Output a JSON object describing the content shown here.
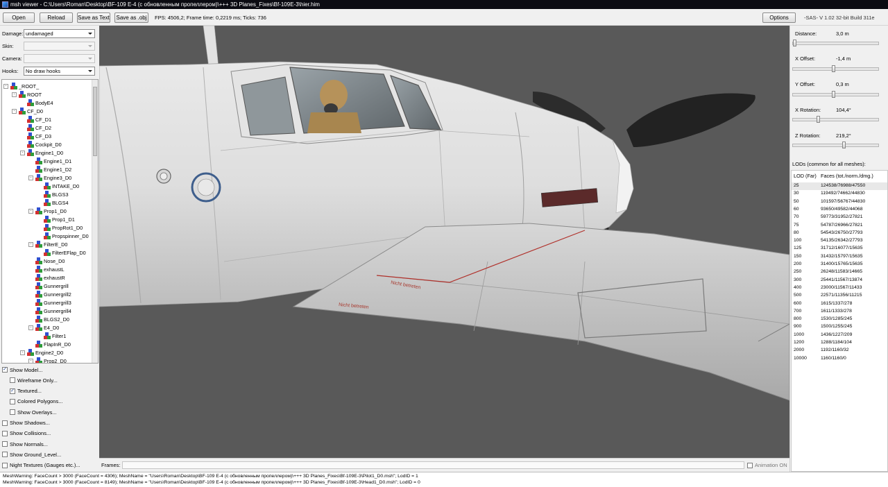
{
  "window": {
    "title": "msh viewer - C:\\Users\\Roman\\Desktop\\BF-109 E-4 (с обновленным пропеллером)\\+++ 3D Planes_Fixes\\Bf-109E-3\\hier.him"
  },
  "toolbar": {
    "open": "Open",
    "reload": "Reload",
    "save_text": "Save as Text",
    "save_obj": "Save as .obj",
    "fps": "FPS: 4506,2; Frame time: 0,2219 ms; Ticks: 736",
    "options": "Options",
    "version": "-SAS- V 1.02  32-bit  Build 311e"
  },
  "left": {
    "damage_label": "Damage:",
    "damage_value": "undamaged",
    "skin_label": "Skin:",
    "skin_value": "",
    "camera_label": "Camera:",
    "camera_value": "",
    "hooks_label": "Hooks:",
    "hooks_value": "No draw hooks",
    "tree": [
      {
        "label": "_ROOT_",
        "depth": 0,
        "expander": "-",
        "root": true
      },
      {
        "label": "ROOT",
        "depth": 1,
        "expander": "-"
      },
      {
        "label": "BodyE4",
        "depth": 2,
        "expander": ""
      },
      {
        "label": "CF_D0",
        "depth": 1,
        "expander": "-"
      },
      {
        "label": "CF_D1",
        "depth": 2,
        "expander": ""
      },
      {
        "label": "CF_D2",
        "depth": 2,
        "expander": ""
      },
      {
        "label": "CF_D3",
        "depth": 2,
        "expander": ""
      },
      {
        "label": "Cockpit_D0",
        "depth": 2,
        "expander": ""
      },
      {
        "label": "Engine1_D0",
        "depth": 2,
        "expander": "-"
      },
      {
        "label": "Engine1_D1",
        "depth": 3,
        "expander": ""
      },
      {
        "label": "Engine1_D2",
        "depth": 3,
        "expander": ""
      },
      {
        "label": "Engine3_D0",
        "depth": 3,
        "expander": "-"
      },
      {
        "label": "INTAKE_D0",
        "depth": 4,
        "expander": ""
      },
      {
        "label": "BLGS3",
        "depth": 4,
        "expander": ""
      },
      {
        "label": "BLGS4",
        "depth": 4,
        "expander": ""
      },
      {
        "label": "Prop1_D0",
        "depth": 3,
        "expander": "-"
      },
      {
        "label": "Prop1_D1",
        "depth": 4,
        "expander": ""
      },
      {
        "label": "PropRot1_D0",
        "depth": 4,
        "expander": ""
      },
      {
        "label": "Propspinner_D0",
        "depth": 4,
        "expander": ""
      },
      {
        "label": "FilterE_D0",
        "depth": 3,
        "expander": "-"
      },
      {
        "label": "FilterEFlap_D0",
        "depth": 4,
        "expander": ""
      },
      {
        "label": "Nose_D0",
        "depth": 3,
        "expander": ""
      },
      {
        "label": "exhaustL",
        "depth": 3,
        "expander": ""
      },
      {
        "label": "exhaustR",
        "depth": 3,
        "expander": ""
      },
      {
        "label": "Gunnergrill",
        "depth": 3,
        "expander": ""
      },
      {
        "label": "Gunnergrill2",
        "depth": 3,
        "expander": ""
      },
      {
        "label": "Gunnergrill3",
        "depth": 3,
        "expander": ""
      },
      {
        "label": "Gunnergrill4",
        "depth": 3,
        "expander": ""
      },
      {
        "label": "BLGS2_D0",
        "depth": 3,
        "expander": ""
      },
      {
        "label": "E4_D0",
        "depth": 3,
        "expander": "-"
      },
      {
        "label": "Filter1",
        "depth": 4,
        "expander": ""
      },
      {
        "label": "FlapInR_D0",
        "depth": 3,
        "expander": ""
      },
      {
        "label": "Engine2_D0",
        "depth": 2,
        "expander": "-"
      },
      {
        "label": "Prop2_D0",
        "depth": 3,
        "expander": "-"
      }
    ],
    "checks": [
      {
        "label": "Show Model...",
        "checked": true,
        "indent": 0
      },
      {
        "label": "Wireframe Only...",
        "checked": false,
        "indent": 1
      },
      {
        "label": "Textured...",
        "checked": true,
        "indent": 1
      },
      {
        "label": "Colored Polygons...",
        "checked": false,
        "indent": 1
      },
      {
        "label": "Show Overlays...",
        "checked": false,
        "indent": 1
      },
      {
        "label": "Show Shadows...",
        "checked": false,
        "indent": 0
      },
      {
        "label": "Show Collisions...",
        "checked": false,
        "indent": 0
      },
      {
        "label": "Show Normals...",
        "checked": false,
        "indent": 0
      },
      {
        "label": "Show Ground_Level...",
        "checked": false,
        "indent": 0
      },
      {
        "label": "Night Textures (Gauges etc.)...",
        "checked": false,
        "indent": 0
      }
    ]
  },
  "viewport": {
    "decal_1": "Nicht betreten",
    "decal_2": "Nicht betreten"
  },
  "frames": {
    "label": "Frames:",
    "animation": "Animation ON",
    "animation_checked": false
  },
  "right": {
    "distance_label": "Distance:",
    "distance_value": "3,0 m",
    "distance_level": 0.0,
    "xoffset_label": "X Offset:",
    "xoffset_value": "-1,4 m",
    "xoffset_level": 0.48,
    "yoffset_label": "Y Offset:",
    "yoffset_value": "0,3 m",
    "yoffset_level": 0.48,
    "xrot_label": "X Rotation:",
    "xrot_value": "104,4°",
    "xrot_level": 0.29,
    "zrot_label": "Z Rotation:",
    "zrot_value": "219,2°",
    "zrot_level": 0.61,
    "lod_header": "LODs (common for all meshes):",
    "lod_col1": "LOD (Far)",
    "lod_col2": "Faces (tot./norm./dmg.)",
    "lods": [
      {
        "lod": "25",
        "faces": "124538/76988/47550"
      },
      {
        "lod": "30",
        "faces": "119492/74662/44830"
      },
      {
        "lod": "50",
        "faces": "101597/56767/44830"
      },
      {
        "lod": "60",
        "faces": "93650/49582/44068"
      },
      {
        "lod": "70",
        "faces": "59773/31952/27821"
      },
      {
        "lod": "75",
        "faces": "54787/26966/27821"
      },
      {
        "lod": "80",
        "faces": "54543/26750/27793"
      },
      {
        "lod": "100",
        "faces": "54135/26342/27793"
      },
      {
        "lod": "125",
        "faces": "31712/16077/15635"
      },
      {
        "lod": "150",
        "faces": "31432/15797/15635"
      },
      {
        "lod": "200",
        "faces": "31400/15765/15635"
      },
      {
        "lod": "250",
        "faces": "26248/11583/14665"
      },
      {
        "lod": "300",
        "faces": "25441/11567/13874"
      },
      {
        "lod": "400",
        "faces": "23000/11567/11433"
      },
      {
        "lod": "500",
        "faces": "22571/11356/11215"
      },
      {
        "lod": "600",
        "faces": "1615/1337/278"
      },
      {
        "lod": "700",
        "faces": "1611/1333/278"
      },
      {
        "lod": "800",
        "faces": "1530/1285/245"
      },
      {
        "lod": "900",
        "faces": "1500/1255/245"
      },
      {
        "lod": "1000",
        "faces": "1436/1227/209"
      },
      {
        "lod": "1200",
        "faces": "1288/1184/104"
      },
      {
        "lod": "2000",
        "faces": "1192/1160/32"
      },
      {
        "lod": "10000",
        "faces": "1160/1160/0"
      }
    ]
  },
  "log": {
    "line1": "MeshWarning: FaceCount > 3000 (FaceCount = 4306); MeshName = \"Users\\Roman\\Desktop\\BF-109 E-4 (с обновленным пропеллером)\\+++ 3D Planes_Fixes\\Bf-109E-3\\Pilot1_D0.msh\"; LodID = 1",
    "line2": "MeshWarning: FaceCount > 3000 (FaceCount = 8149); MeshName = \"Users\\Roman\\Desktop\\BF-109 E-4 (с обновленным пропеллером)\\+++ 3D Planes_Fixes\\Bf-109E-3\\Head1_D0.msh\"; LodID = 0"
  }
}
